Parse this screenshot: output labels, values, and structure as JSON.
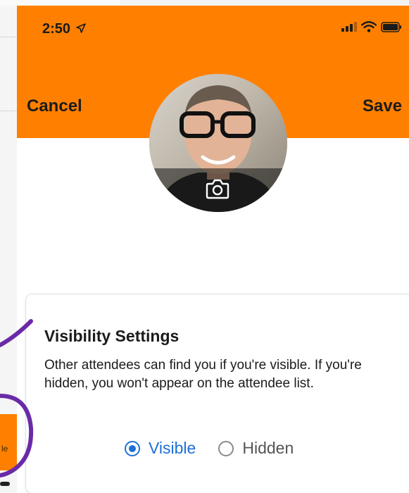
{
  "status_bar": {
    "time": "2:50"
  },
  "header": {
    "cancel_label": "Cancel",
    "save_label": "Save",
    "color": "#ff8000"
  },
  "profile": {
    "photo_alt": "Profile photo",
    "camera_icon": "camera-icon"
  },
  "visibility_card": {
    "title": "Visibility Settings",
    "description": "Other attendees can find you if you're visible. If you're hidden, you won't appear on the attendee list.",
    "options": [
      {
        "label": "Visible",
        "selected": true
      },
      {
        "label": "Hidden",
        "selected": false
      }
    ],
    "accent": "#1e6fd6"
  },
  "background_app": {
    "tab_label": "le"
  },
  "annotation": {
    "color": "#6a2aa8"
  }
}
